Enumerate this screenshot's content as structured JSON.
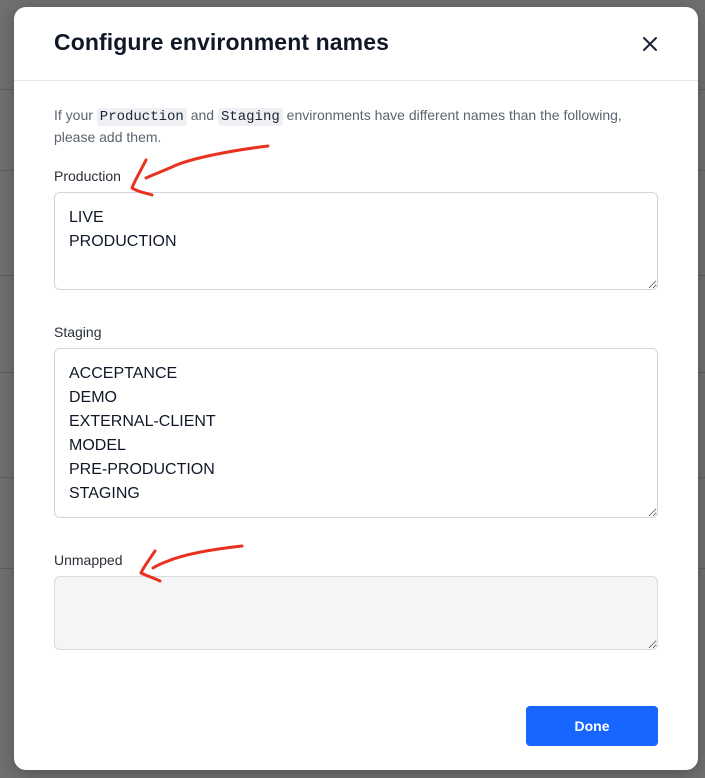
{
  "modal": {
    "title": "Configure environment names",
    "description_part1": "If your ",
    "description_code1": "Production",
    "description_part2": " and ",
    "description_code2": "Staging",
    "description_part3": " environments have different names than the following, please add them.",
    "close_icon": "close-icon",
    "done_label": "Done"
  },
  "fields": {
    "production": {
      "label": "Production",
      "value": "LIVE\nPRODUCTION"
    },
    "staging": {
      "label": "Staging",
      "value": "ACCEPTANCE\nDEMO\nEXTERNAL-CLIENT\nMODEL\nPRE-PRODUCTION\nSTAGING"
    },
    "unmapped": {
      "label": "Unmapped",
      "value": ""
    }
  },
  "colors": {
    "primary": "#1766ff",
    "annotation": "#e8321f"
  }
}
